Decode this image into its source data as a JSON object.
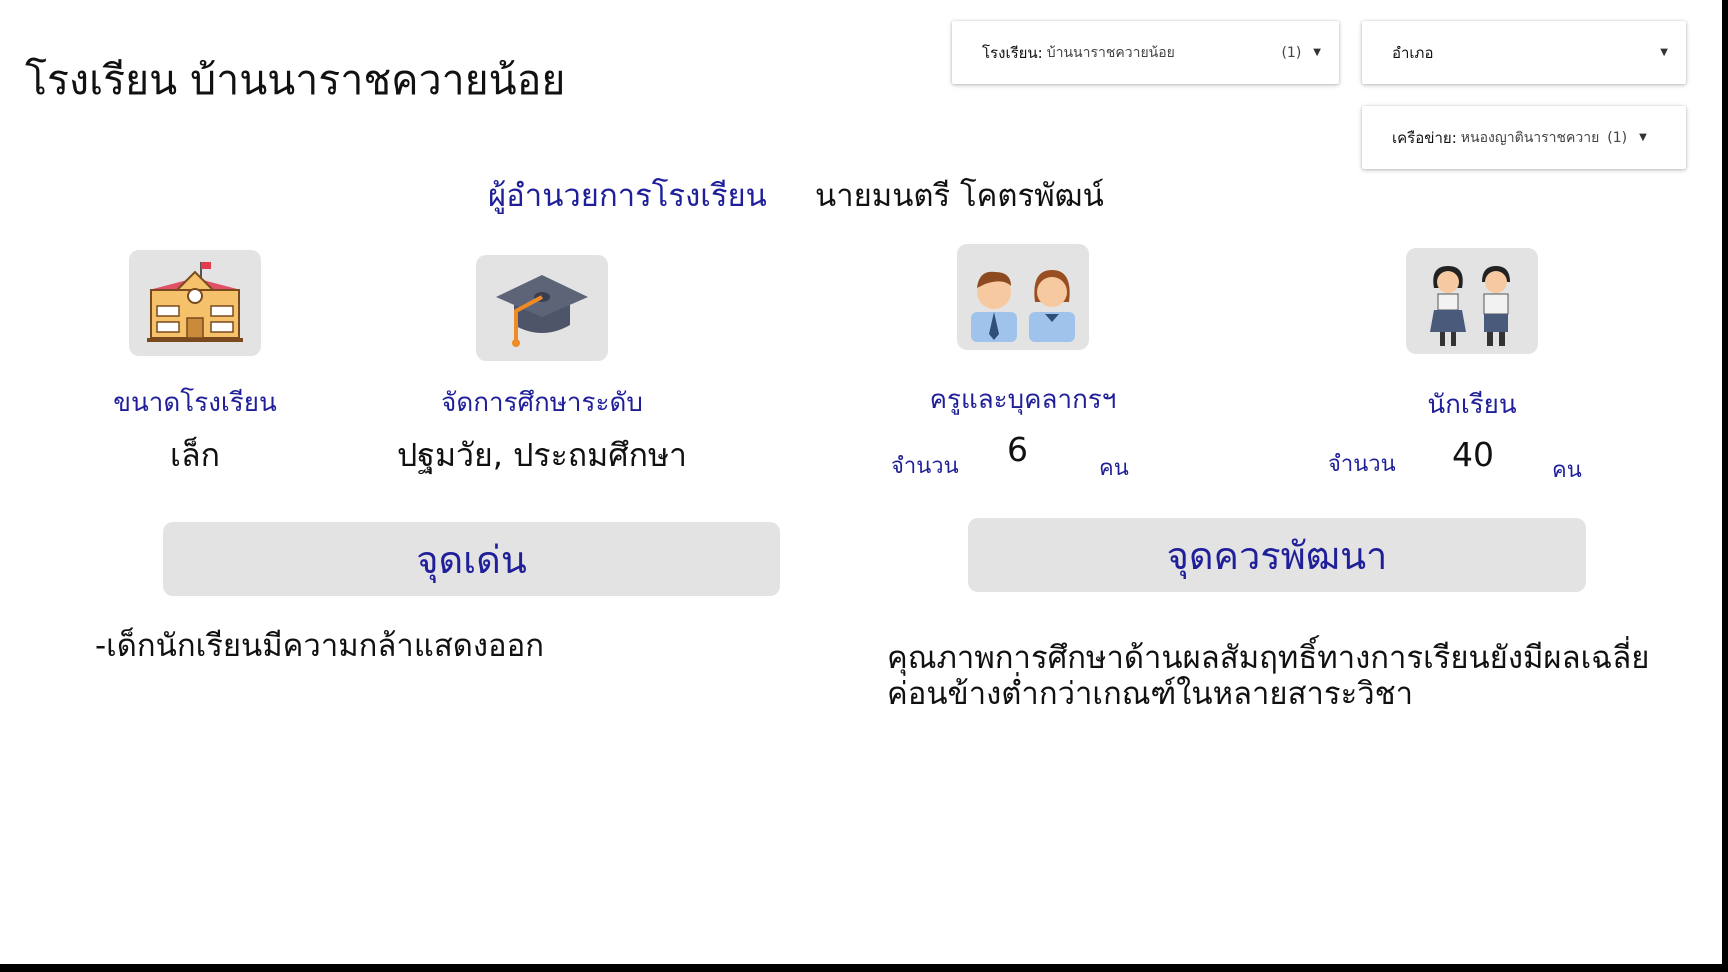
{
  "page": {
    "title": "โรงเรียน บ้านนาราชควายน้อย"
  },
  "filters": {
    "school": {
      "label": "โรงเรียน",
      "value": "บ้านนาราชควายน้อย",
      "count": "(1)"
    },
    "district": {
      "label": "อำเภอ"
    },
    "network": {
      "label": "เครือข่าย",
      "value": "หนองญาตินาราชควาย",
      "count": "(1)"
    }
  },
  "director": {
    "label": "ผู้อำนวยการโรงเรียน",
    "name": "นายมนตรี โคตรพัฒน์"
  },
  "cards": {
    "size": {
      "label": "ขนาดโรงเรียน",
      "value": "เล็ก",
      "icon": "school-building-icon"
    },
    "level": {
      "label": "จัดการศึกษาระดับ",
      "value": "ปฐมวัย, ประถมศึกษา",
      "icon": "graduation-cap-icon"
    },
    "staff": {
      "label": "ครูและบุคลากรฯ",
      "count_label": "จำนวน",
      "count": "6",
      "unit": "คน",
      "icon": "teachers-icon"
    },
    "students": {
      "label": "นักเรียน",
      "count_label": "จำนวน",
      "count": "40",
      "unit": "คน",
      "icon": "students-icon"
    }
  },
  "strengths": {
    "heading": "จุดเด่น",
    "text": "-เด็กนักเรียนมีความกล้าแสดงออก"
  },
  "improvements": {
    "heading": "จุดควรพัฒนา",
    "text": "คุณภาพการศึกษาด้านผลสัมฤทธิ์ทางการเรียนยังมีผลเฉลี่ยค่อนข้างต่ำกว่าเกณฑ์ในหลายสาระวิชา"
  },
  "colors": {
    "accent": "#1f1f99",
    "panel": "#e3e3e3"
  }
}
